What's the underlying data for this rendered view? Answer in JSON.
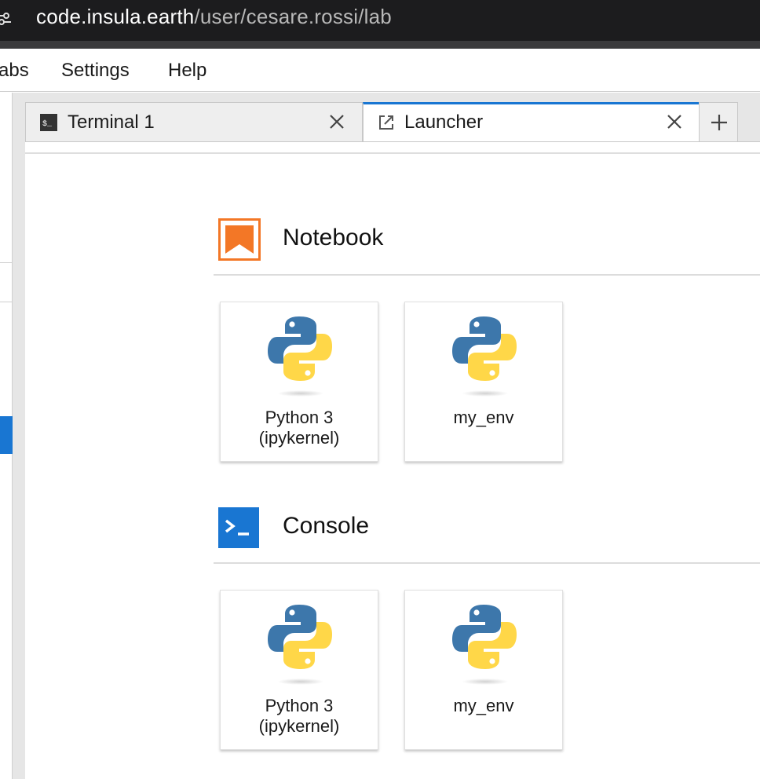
{
  "browser": {
    "url_host": "code.insula.earth",
    "url_path": "/user/cesare.rossi/lab"
  },
  "menubar": {
    "items": [
      "abs",
      "Settings",
      "Help"
    ]
  },
  "tabs": [
    {
      "label": "Terminal 1",
      "icon": "terminal-icon",
      "active": false
    },
    {
      "label": "Launcher",
      "icon": "launch-icon",
      "active": true
    }
  ],
  "colors": {
    "accent": "#1976d2",
    "notebook_orange": "#f37726",
    "console_blue": "#1976d2",
    "python_blue": "#3d77ab",
    "python_yellow": "#ffd748"
  },
  "launcher": {
    "sections": [
      {
        "title": "Notebook",
        "icon": "notebook-icon",
        "items": [
          {
            "label": "Python 3\n(ipykernel)",
            "icon": "python-logo-icon"
          },
          {
            "label": "my_env",
            "icon": "python-logo-icon"
          }
        ]
      },
      {
        "title": "Console",
        "icon": "console-icon",
        "items": [
          {
            "label": "Python 3\n(ipykernel)",
            "icon": "python-logo-icon"
          },
          {
            "label": "my_env",
            "icon": "python-logo-icon"
          }
        ]
      }
    ]
  }
}
